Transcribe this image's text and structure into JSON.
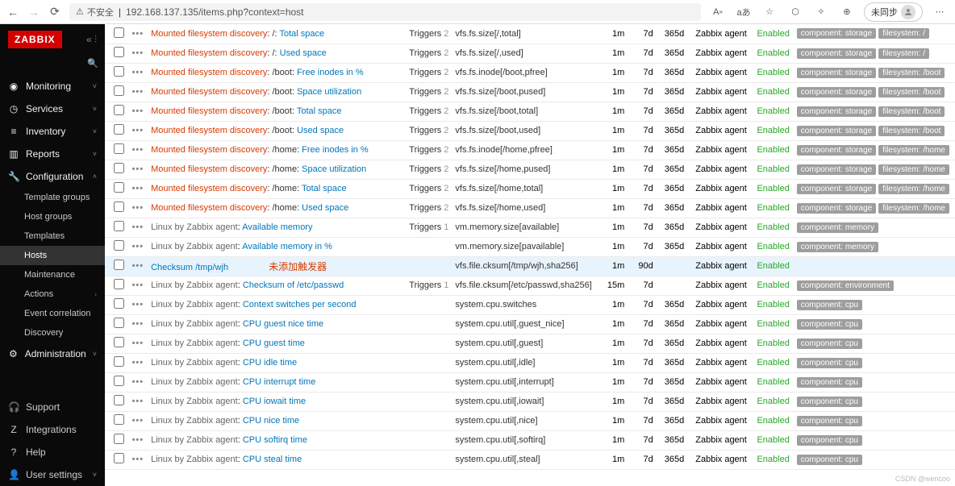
{
  "browser": {
    "insecure_label": "不安全",
    "url": "192.168.137.135/items.php?context=host",
    "sync_label": "未同步"
  },
  "sidebar": {
    "logo": "ZABBIX",
    "nav": [
      {
        "icon": "eye",
        "label": "Monitoring",
        "expand": true
      },
      {
        "icon": "gauge",
        "label": "Services",
        "expand": true
      },
      {
        "icon": "list",
        "label": "Inventory",
        "expand": true
      },
      {
        "icon": "bar",
        "label": "Reports",
        "expand": true
      },
      {
        "icon": "wrench",
        "label": "Configuration",
        "expand": true,
        "open": true,
        "subs": [
          {
            "label": "Template groups"
          },
          {
            "label": "Host groups"
          },
          {
            "label": "Templates"
          },
          {
            "label": "Hosts",
            "active": true
          },
          {
            "label": "Maintenance"
          },
          {
            "label": "Actions",
            "expand": true
          },
          {
            "label": "Event correlation"
          },
          {
            "label": "Discovery"
          }
        ]
      },
      {
        "icon": "gear",
        "label": "Administration",
        "expand": true
      }
    ],
    "foot": [
      {
        "icon": "head",
        "label": "Support"
      },
      {
        "icon": "z",
        "label": "Integrations"
      },
      {
        "icon": "q",
        "label": "Help"
      },
      {
        "icon": "user",
        "label": "User settings",
        "expand": true
      }
    ]
  },
  "rows": [
    {
      "disc": "Mounted filesystem discovery",
      "sep": ": /: ",
      "item": "Total space",
      "trig": "2",
      "key": "vfs.fs.size[/,total]",
      "int": "1m",
      "hist": "7d",
      "trend": "365d",
      "type": "Zabbix agent",
      "status": "Enabled",
      "tags": [
        "component: storage",
        "filesystem: /"
      ]
    },
    {
      "disc": "Mounted filesystem discovery",
      "sep": ": /: ",
      "item": "Used space",
      "trig": "2",
      "key": "vfs.fs.size[/,used]",
      "int": "1m",
      "hist": "7d",
      "trend": "365d",
      "type": "Zabbix agent",
      "status": "Enabled",
      "tags": [
        "component: storage",
        "filesystem: /"
      ]
    },
    {
      "disc": "Mounted filesystem discovery",
      "sep": ": /boot: ",
      "item": "Free inodes in %",
      "trig": "2",
      "key": "vfs.fs.inode[/boot,pfree]",
      "int": "1m",
      "hist": "7d",
      "trend": "365d",
      "type": "Zabbix agent",
      "status": "Enabled",
      "tags": [
        "component: storage",
        "filesystem: /boot"
      ]
    },
    {
      "disc": "Mounted filesystem discovery",
      "sep": ": /boot: ",
      "item": "Space utilization",
      "trig": "2",
      "key": "vfs.fs.size[/boot,pused]",
      "int": "1m",
      "hist": "7d",
      "trend": "365d",
      "type": "Zabbix agent",
      "status": "Enabled",
      "tags": [
        "component: storage",
        "filesystem: /boot"
      ]
    },
    {
      "disc": "Mounted filesystem discovery",
      "sep": ": /boot: ",
      "item": "Total space",
      "trig": "2",
      "key": "vfs.fs.size[/boot,total]",
      "int": "1m",
      "hist": "7d",
      "trend": "365d",
      "type": "Zabbix agent",
      "status": "Enabled",
      "tags": [
        "component: storage",
        "filesystem: /boot"
      ]
    },
    {
      "disc": "Mounted filesystem discovery",
      "sep": ": /boot: ",
      "item": "Used space",
      "trig": "2",
      "key": "vfs.fs.size[/boot,used]",
      "int": "1m",
      "hist": "7d",
      "trend": "365d",
      "type": "Zabbix agent",
      "status": "Enabled",
      "tags": [
        "component: storage",
        "filesystem: /boot"
      ]
    },
    {
      "disc": "Mounted filesystem discovery",
      "sep": ": /home: ",
      "item": "Free inodes in %",
      "trig": "2",
      "key": "vfs.fs.inode[/home,pfree]",
      "int": "1m",
      "hist": "7d",
      "trend": "365d",
      "type": "Zabbix agent",
      "status": "Enabled",
      "tags": [
        "component: storage",
        "filesystem: /home"
      ]
    },
    {
      "disc": "Mounted filesystem discovery",
      "sep": ": /home: ",
      "item": "Space utilization",
      "trig": "2",
      "key": "vfs.fs.size[/home,pused]",
      "int": "1m",
      "hist": "7d",
      "trend": "365d",
      "type": "Zabbix agent",
      "status": "Enabled",
      "tags": [
        "component: storage",
        "filesystem: /home"
      ]
    },
    {
      "disc": "Mounted filesystem discovery",
      "sep": ": /home: ",
      "item": "Total space",
      "trig": "2",
      "key": "vfs.fs.size[/home,total]",
      "int": "1m",
      "hist": "7d",
      "trend": "365d",
      "type": "Zabbix agent",
      "status": "Enabled",
      "tags": [
        "component: storage",
        "filesystem: /home"
      ]
    },
    {
      "disc": "Mounted filesystem discovery",
      "sep": ": /home: ",
      "item": "Used space",
      "trig": "2",
      "key": "vfs.fs.size[/home,used]",
      "int": "1m",
      "hist": "7d",
      "trend": "365d",
      "type": "Zabbix agent",
      "status": "Enabled",
      "tags": [
        "component: storage",
        "filesystem: /home"
      ]
    },
    {
      "disc": "Linux by Zabbix agent",
      "sep": ": ",
      "color": "#666",
      "item": "Available memory",
      "trig": "1",
      "key": "vm.memory.size[available]",
      "int": "1m",
      "hist": "7d",
      "trend": "365d",
      "type": "Zabbix agent",
      "status": "Enabled",
      "tags": [
        "component: memory"
      ]
    },
    {
      "disc": "Linux by Zabbix agent",
      "sep": ": ",
      "color": "#666",
      "item": "Available memory in %",
      "trig": "",
      "key": "vm.memory.size[pavailable]",
      "int": "1m",
      "hist": "7d",
      "trend": "365d",
      "type": "Zabbix agent",
      "status": "Enabled",
      "tags": [
        "component: memory"
      ]
    },
    {
      "disc": "",
      "sep": "",
      "item": "Checksum /tmp/wjh",
      "annotation": "未添加触发器",
      "trig": "",
      "key": "vfs.file.cksum[/tmp/wjh,sha256]",
      "int": "1m",
      "hist": "90d",
      "trend": "",
      "type": "Zabbix agent",
      "status": "Enabled",
      "tags": [],
      "hl": true
    },
    {
      "disc": "Linux by Zabbix agent",
      "sep": ": ",
      "color": "#666",
      "item": "Checksum of /etc/passwd",
      "trig": "1",
      "key": "vfs.file.cksum[/etc/passwd,sha256]",
      "int": "15m",
      "hist": "7d",
      "trend": "",
      "type": "Zabbix agent",
      "status": "Enabled",
      "tags": [
        "component: environment"
      ]
    },
    {
      "disc": "Linux by Zabbix agent",
      "sep": ": ",
      "color": "#666",
      "item": "Context switches per second",
      "trig": "",
      "key": "system.cpu.switches",
      "int": "1m",
      "hist": "7d",
      "trend": "365d",
      "type": "Zabbix agent",
      "status": "Enabled",
      "tags": [
        "component: cpu"
      ]
    },
    {
      "disc": "Linux by Zabbix agent",
      "sep": ": ",
      "color": "#666",
      "item": "CPU guest nice time",
      "trig": "",
      "key": "system.cpu.util[,guest_nice]",
      "int": "1m",
      "hist": "7d",
      "trend": "365d",
      "type": "Zabbix agent",
      "status": "Enabled",
      "tags": [
        "component: cpu"
      ]
    },
    {
      "disc": "Linux by Zabbix agent",
      "sep": ": ",
      "color": "#666",
      "item": "CPU guest time",
      "trig": "",
      "key": "system.cpu.util[,guest]",
      "int": "1m",
      "hist": "7d",
      "trend": "365d",
      "type": "Zabbix agent",
      "status": "Enabled",
      "tags": [
        "component: cpu"
      ]
    },
    {
      "disc": "Linux by Zabbix agent",
      "sep": ": ",
      "color": "#666",
      "item": "CPU idle time",
      "trig": "",
      "key": "system.cpu.util[,idle]",
      "int": "1m",
      "hist": "7d",
      "trend": "365d",
      "type": "Zabbix agent",
      "status": "Enabled",
      "tags": [
        "component: cpu"
      ]
    },
    {
      "disc": "Linux by Zabbix agent",
      "sep": ": ",
      "color": "#666",
      "item": "CPU interrupt time",
      "trig": "",
      "key": "system.cpu.util[,interrupt]",
      "int": "1m",
      "hist": "7d",
      "trend": "365d",
      "type": "Zabbix agent",
      "status": "Enabled",
      "tags": [
        "component: cpu"
      ]
    },
    {
      "disc": "Linux by Zabbix agent",
      "sep": ": ",
      "color": "#666",
      "item": "CPU iowait time",
      "trig": "",
      "key": "system.cpu.util[,iowait]",
      "int": "1m",
      "hist": "7d",
      "trend": "365d",
      "type": "Zabbix agent",
      "status": "Enabled",
      "tags": [
        "component: cpu"
      ]
    },
    {
      "disc": "Linux by Zabbix agent",
      "sep": ": ",
      "color": "#666",
      "item": "CPU nice time",
      "trig": "",
      "key": "system.cpu.util[,nice]",
      "int": "1m",
      "hist": "7d",
      "trend": "365d",
      "type": "Zabbix agent",
      "status": "Enabled",
      "tags": [
        "component: cpu"
      ]
    },
    {
      "disc": "Linux by Zabbix agent",
      "sep": ": ",
      "color": "#666",
      "item": "CPU softirq time",
      "trig": "",
      "key": "system.cpu.util[,softirq]",
      "int": "1m",
      "hist": "7d",
      "trend": "365d",
      "type": "Zabbix agent",
      "status": "Enabled",
      "tags": [
        "component: cpu"
      ]
    },
    {
      "disc": "Linux by Zabbix agent",
      "sep": ": ",
      "color": "#666",
      "item": "CPU steal time",
      "trig": "",
      "key": "system.cpu.util[,steal]",
      "int": "1m",
      "hist": "7d",
      "trend": "365d",
      "type": "Zabbix agent",
      "status": "Enabled",
      "tags": [
        "component: cpu"
      ]
    }
  ],
  "labels": {
    "triggers": "Triggers"
  },
  "watermark": "CSDN @wencoo"
}
